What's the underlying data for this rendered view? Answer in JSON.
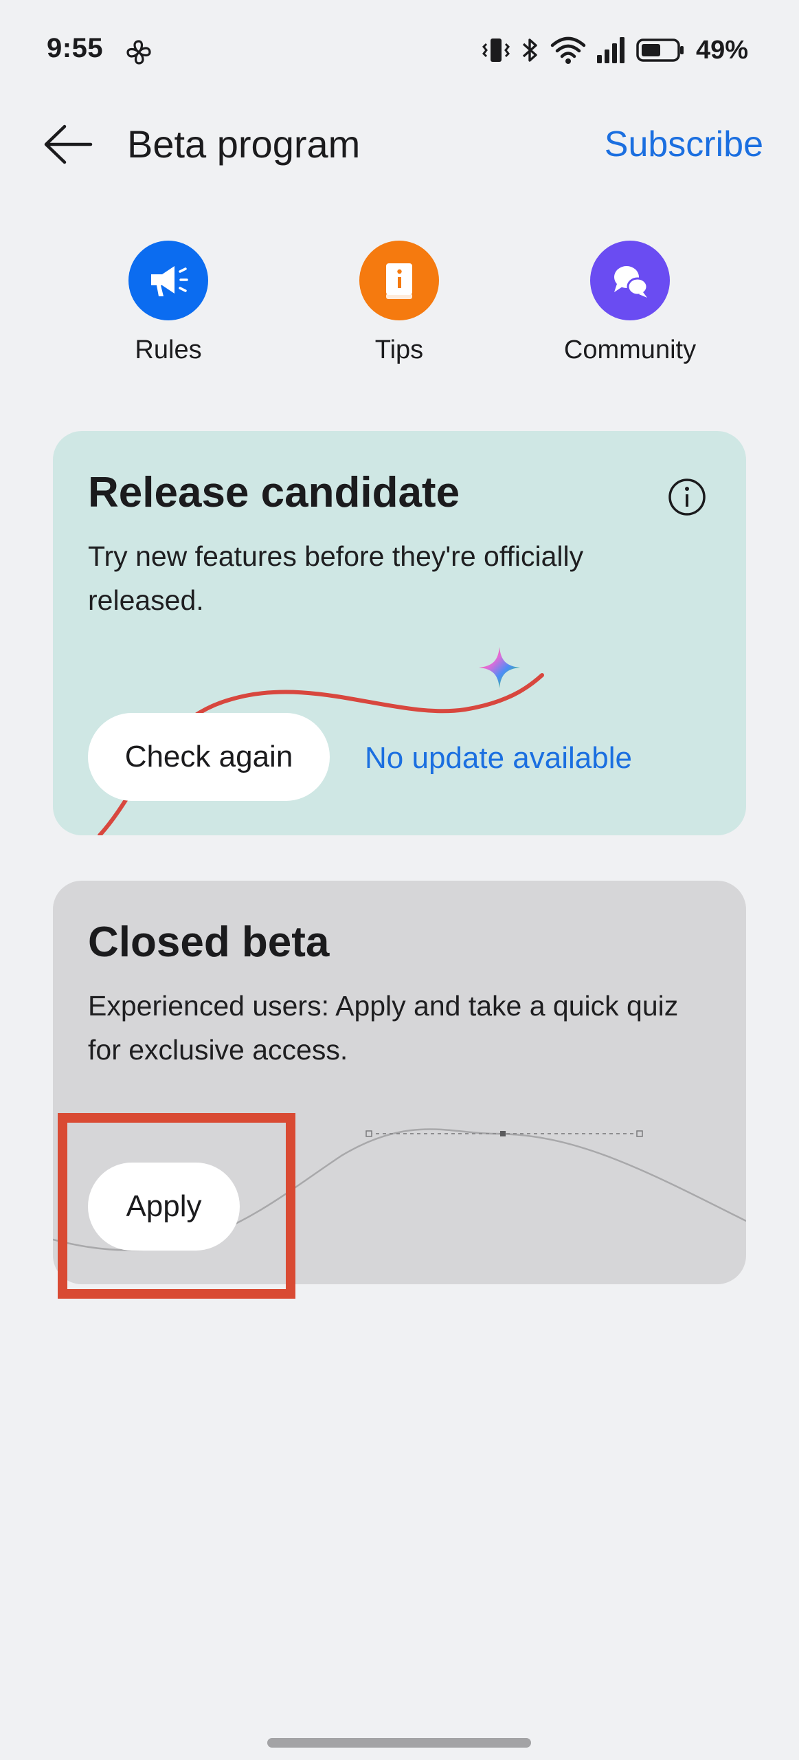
{
  "status_bar": {
    "time": "9:55",
    "battery_percent": "49%",
    "icons": [
      "fan-icon",
      "vibrate-icon",
      "bluetooth-icon",
      "wifi-icon",
      "signal-icon",
      "battery-icon"
    ]
  },
  "header": {
    "title": "Beta program",
    "subscribe_label": "Subscribe"
  },
  "quick_actions": [
    {
      "label": "Rules",
      "icon": "megaphone-icon",
      "color": "#0B6CF0"
    },
    {
      "label": "Tips",
      "icon": "book-info-icon",
      "color": "#F57A0F"
    },
    {
      "label": "Community",
      "icon": "chat-bubbles-icon",
      "color": "#6A4CF2"
    }
  ],
  "release_candidate": {
    "title": "Release candidate",
    "description": "Try new features before they're officially released.",
    "button_label": "Check again",
    "status": "No update available",
    "background": "#CFE7E4"
  },
  "closed_beta": {
    "title": "Closed beta",
    "description": "Experienced users: Apply and take a quick quiz for exclusive access.",
    "button_label": "Apply",
    "background": "#D6D6D8"
  },
  "colors": {
    "accent": "#1B6FE0",
    "highlight": "#D94A33"
  }
}
